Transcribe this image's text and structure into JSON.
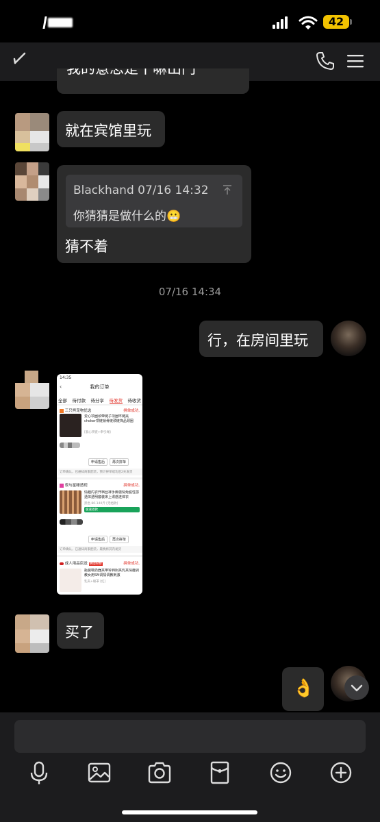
{
  "status_bar": {
    "battery": "42"
  },
  "messages": {
    "partial_top": "我的意思是干嘛出门",
    "msg1": "就在宾馆里玩",
    "quote": {
      "header": "Blackhand 07/16 14:32",
      "text": "你猜猜是做什么的😬"
    },
    "msg2": "猜不着",
    "timestamp": "07/16 14:34",
    "msg3": "行，在房间里玩",
    "msg4": "买了",
    "msg5": "👌"
  },
  "screenshot": {
    "time": "14:35",
    "title": "我的订单",
    "tabs": [
      "全部",
      "待付款",
      "待分享",
      "待发货",
      "待收货"
    ],
    "active_tab": "待发货",
    "orders": [
      {
        "shop": "三只熊宠物优选",
        "status": "拼单成功,",
        "desc": "爱心项圈颈带链子项圈环链黑choker项链锁骨链颈链饰品颈圈",
        "spec": "[爱心项链+牵引绳]",
        "action1": "申请售后",
        "action2": "再次拼单",
        "note": "订单确认，已通知商家配货，预计拼单成功后2天发货"
      },
      {
        "shop": "夜与星睡透视",
        "status": "拼单成功,",
        "desc": "情趣内衣开档丝袜手脚激情免脱性感透体透明套装床上诱惑连体衣",
        "spec": "黑色 80-140斤 [无裆款]",
        "badge": "极速退款",
        "action1": "申请售后",
        "action2": "再次拼单",
        "note": "订单确认，已通知商家配货，最晚将其内发货"
      },
      {
        "shop": "成人用品店送",
        "tag": "拼团购物",
        "status": "拼单成功,",
        "desc": "瓶装吸奶器夹带铃铛阴夹乳夹情趣调教女用SM调情调教刺激",
        "spec": "乳夹+眼罩 [红]"
      }
    ]
  }
}
